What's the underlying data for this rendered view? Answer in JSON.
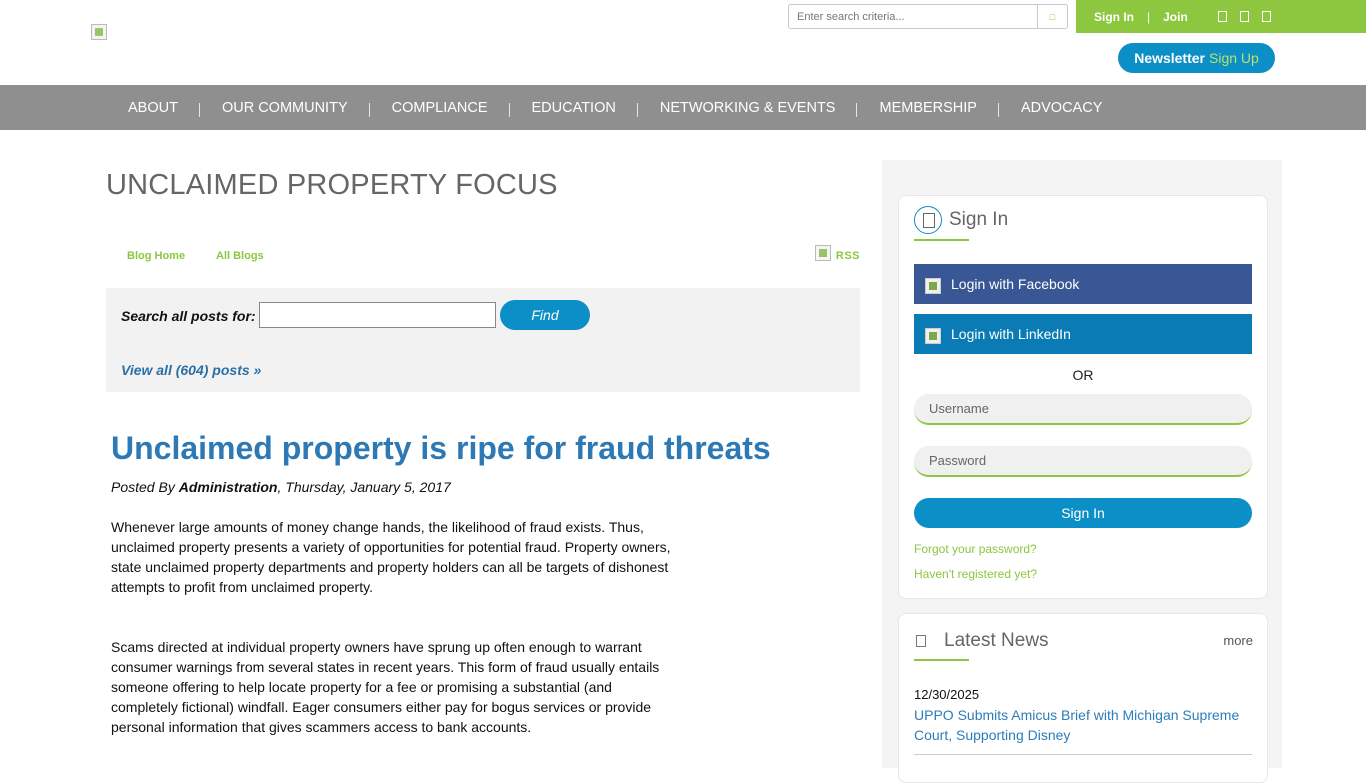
{
  "header": {
    "search_placeholder": "Enter search criteria...",
    "sign_in": "Sign In",
    "separator": "|",
    "join": "Join",
    "newsletter_bold": "Newsletter",
    "newsletter_rest": "Sign Up"
  },
  "nav": {
    "items": [
      "ABOUT",
      "OUR COMMUNITY",
      "COMPLIANCE",
      "EDUCATION",
      "NETWORKING & EVENTS",
      "MEMBERSHIP",
      "ADVOCACY"
    ]
  },
  "blog": {
    "title": "UNCLAIMED PROPERTY FOCUS",
    "blog_home": "Blog Home",
    "all_blogs": "All Blogs",
    "rss": "RSS",
    "search_label": "Search all posts for:",
    "find": "Find",
    "view_all": "View all (604) posts »"
  },
  "post": {
    "title": "Unclaimed property is ripe for fraud threats",
    "posted_by_prefix": "Posted By ",
    "author": "Administration",
    "date": ", Thursday, January 5, 2017",
    "paragraph1": "Whenever large amounts of money change hands, the likelihood of fraud exists. Thus, unclaimed property presents a variety of opportunities for potential fraud. Property owners, state unclaimed property departments and property holders can all be targets of dishonest attempts to profit from unclaimed property.",
    "paragraph2": "Scams directed at individual property owners have sprung up often enough to warrant consumer warnings from several states in recent years. This form of fraud usually entails someone offering to help locate property for a fee or promising a substantial (and completely fictional) windfall. Eager consumers either pay for bogus services or provide personal information that gives scammers access to bank accounts."
  },
  "sidebar": {
    "signin": {
      "title": "Sign In",
      "facebook": "Login with Facebook",
      "linkedin": "Login with LinkedIn",
      "or": "OR",
      "username_placeholder": "Username",
      "password_placeholder": "Password",
      "button": "Sign In",
      "forgot": "Forgot your password?",
      "register": "Haven't registered yet?"
    },
    "news": {
      "title": "Latest News",
      "more": "more",
      "date": "12/30/2025",
      "headline": "UPPO Submits Amicus Brief with Michigan Supreme Court, Supporting Disney"
    }
  },
  "colors": {
    "green": "#8dc63f",
    "blue": "#0c8fc6",
    "nav_gray": "#8f8f8f",
    "facebook": "#3a5795",
    "linkedin": "#0b7bb6",
    "title_blue": "#2d79b5"
  }
}
